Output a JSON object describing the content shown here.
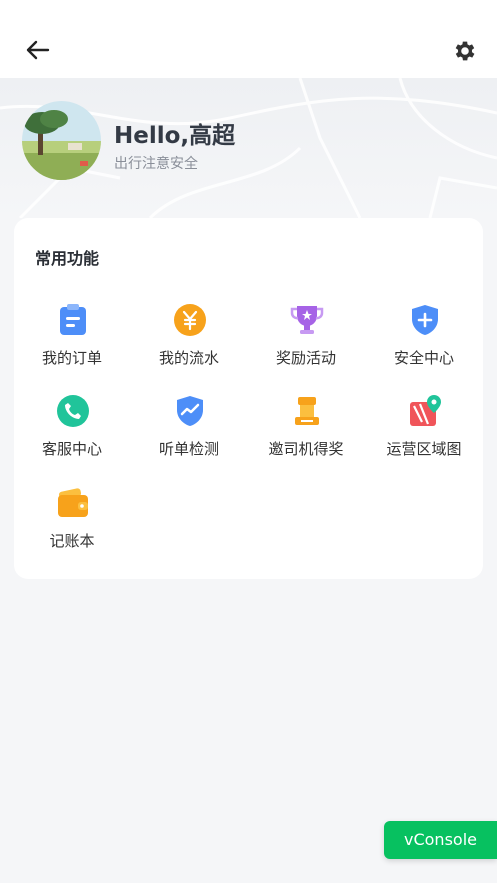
{
  "header": {
    "back_icon": "arrow-left-icon",
    "settings_icon": "gear-icon"
  },
  "profile": {
    "greeting": "Hello,高超",
    "subtitle": "出行注意安全"
  },
  "functions": {
    "title": "常用功能",
    "items": [
      {
        "label": "我的订单",
        "icon": "clipboard-icon",
        "color": "#4d8ef8"
      },
      {
        "label": "我的流水",
        "icon": "yen-coin-icon",
        "color": "#f7a21b"
      },
      {
        "label": "奖励活动",
        "icon": "trophy-icon",
        "color": "#a663e6"
      },
      {
        "label": "安全中心",
        "icon": "shield-plus-icon",
        "color": "#4d8ef8"
      },
      {
        "label": "客服中心",
        "icon": "phone-icon",
        "color": "#20c49a"
      },
      {
        "label": "听单检测",
        "icon": "shield-chart-icon",
        "color": "#4d8ef8"
      },
      {
        "label": "邀司机得奖",
        "icon": "reward-pedestal-icon",
        "color": "#f7a21b"
      },
      {
        "label": "运营区域图",
        "icon": "map-pin-icon",
        "color": "#f0555a"
      },
      {
        "label": "记账本",
        "icon": "wallet-icon",
        "color": "#f7a21b"
      }
    ]
  },
  "vconsole": {
    "label": "vConsole",
    "color": "#07c160"
  }
}
